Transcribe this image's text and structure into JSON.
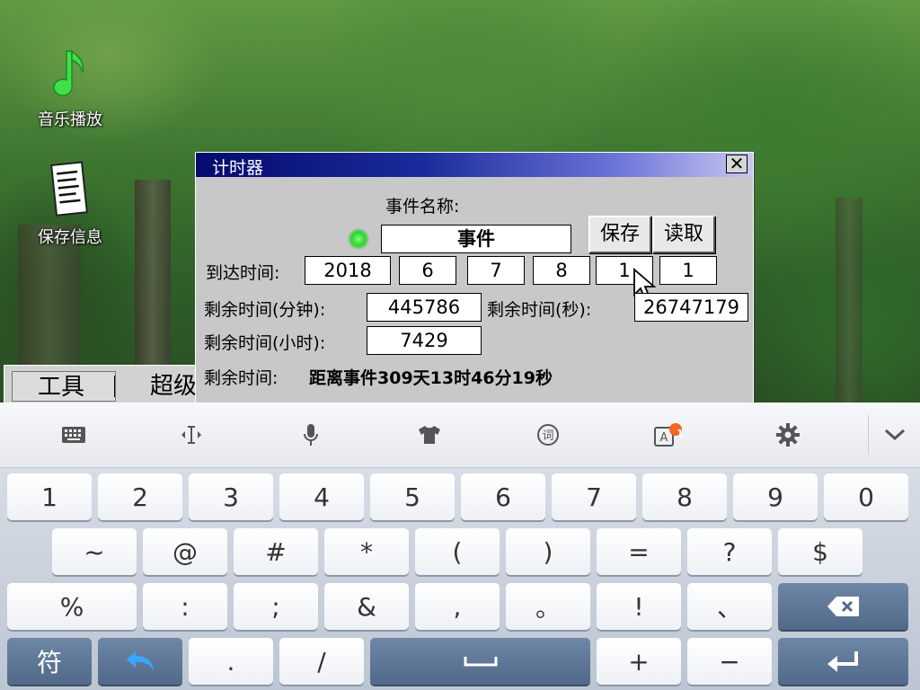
{
  "desktop": {
    "icons": [
      {
        "label": "音乐播放",
        "icon": "music-note-icon"
      },
      {
        "label": "保存信息",
        "icon": "document-icon"
      }
    ]
  },
  "dialog": {
    "title": "计时器",
    "close_glyph": "✕",
    "event_name_label": "事件名称:",
    "event_name_value": "事件",
    "save_label": "保存",
    "load_label": "读取",
    "arrival_label": "到达时间:",
    "arrival_fields": [
      "2018",
      "6",
      "7",
      "8",
      "1",
      "1"
    ],
    "remain_minutes_label": "剩余时间(分钟):",
    "remain_minutes_value": "445786",
    "remain_seconds_label": "剩余时间(秒):",
    "remain_seconds_value": "26747179",
    "remain_hours_label": "剩余时间(小时):",
    "remain_hours_value": "7429",
    "remain_label": "剩余时间:",
    "remain_text": "距离事件309天13时46分19秒"
  },
  "taskbar": {
    "items": [
      "工具",
      "超级"
    ]
  },
  "keyboard": {
    "toolbar": [
      "keyboard-icon",
      "cursor-move-icon",
      "microphone-icon",
      "skin-shirt-icon",
      "word-icon",
      "translate-icon",
      "settings-icon",
      "collapse-icon"
    ],
    "notification_badge": "1",
    "row1": [
      "1",
      "2",
      "3",
      "4",
      "5",
      "6",
      "7",
      "8",
      "9",
      "0"
    ],
    "row2": [
      "~",
      "@",
      "#",
      "*",
      "(",
      ")",
      "=",
      "?",
      "$"
    ],
    "row3": [
      "%",
      ":",
      ";",
      "&",
      ",",
      "。",
      "!",
      "、"
    ],
    "row4": {
      "symbol": "符",
      "dot": ".",
      "slash": "/",
      "plus": "+",
      "minus": "−"
    }
  },
  "colors": {
    "titlebar_start": "#050a6e",
    "dialog_bg": "#c8c8c8",
    "led": "#2fd22f",
    "key_accent": "#3aa6ff"
  }
}
